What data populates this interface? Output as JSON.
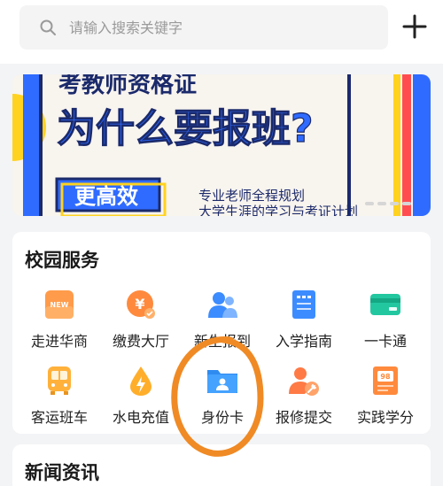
{
  "search": {
    "placeholder": "请输入搜索关键字",
    "icon": "search-icon"
  },
  "header": {
    "add_icon": "plus-icon"
  },
  "banner": {
    "top_text": "考教师资格证",
    "headline": "为什么要报班?",
    "tag": "更高效",
    "subtitle_1": "专业老师全程规划",
    "subtitle_2": "大学生涯的学习与考证计划",
    "colors": {
      "primary": "#2f6bff",
      "yellow": "#ffd21f",
      "red": "#ff4d4f",
      "dark": "#1b2a6b"
    }
  },
  "campus": {
    "title": "校园服务",
    "items": [
      {
        "label": "走进华商",
        "icon": "new-badge-icon"
      },
      {
        "label": "缴费大厅",
        "icon": "yuan-coin-icon"
      },
      {
        "label": "新生报到",
        "icon": "people-icon"
      },
      {
        "label": "入学指南",
        "icon": "document-icon"
      },
      {
        "label": "一卡通",
        "icon": "card-icon"
      },
      {
        "label": "客运班车",
        "icon": "bus-icon"
      },
      {
        "label": "水电充值",
        "icon": "water-drop-bolt-icon"
      },
      {
        "label": "身份卡",
        "icon": "id-folder-icon"
      },
      {
        "label": "报修提交",
        "icon": "repair-icon"
      },
      {
        "label": "实践学分",
        "icon": "score-icon"
      }
    ]
  },
  "news": {
    "title": "新闻资讯"
  },
  "annotation_color": "#f08a24"
}
